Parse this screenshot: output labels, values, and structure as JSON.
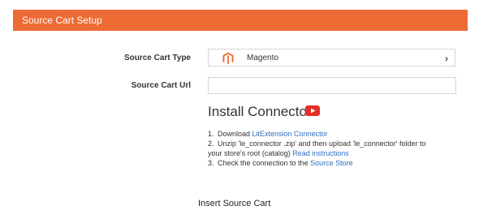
{
  "header": {
    "title": "Source Cart Setup",
    "color": "#EE6B36"
  },
  "form": {
    "type_label": "Source Cart Type",
    "type_value": "Magento",
    "type_icon": "magento-logo",
    "url_label": "Source Cart Url",
    "url_value": ""
  },
  "connector": {
    "title": "Install Connector",
    "icon": "youtube-play-icon",
    "steps": [
      {
        "num": "1.",
        "text": "Download ",
        "link": "LitExtension Connector"
      },
      {
        "num": "2.",
        "text": "Unzip 'le_connector .zip' and then upload 'le_connector' folder to",
        "text2": "your store's root (catalog) ",
        "link": "Read instructions"
      },
      {
        "num": "3.",
        "text": "Check the connection to the ",
        "link": "Source Store"
      }
    ]
  },
  "footer": {
    "insert_label": "Insert Source Cart"
  }
}
